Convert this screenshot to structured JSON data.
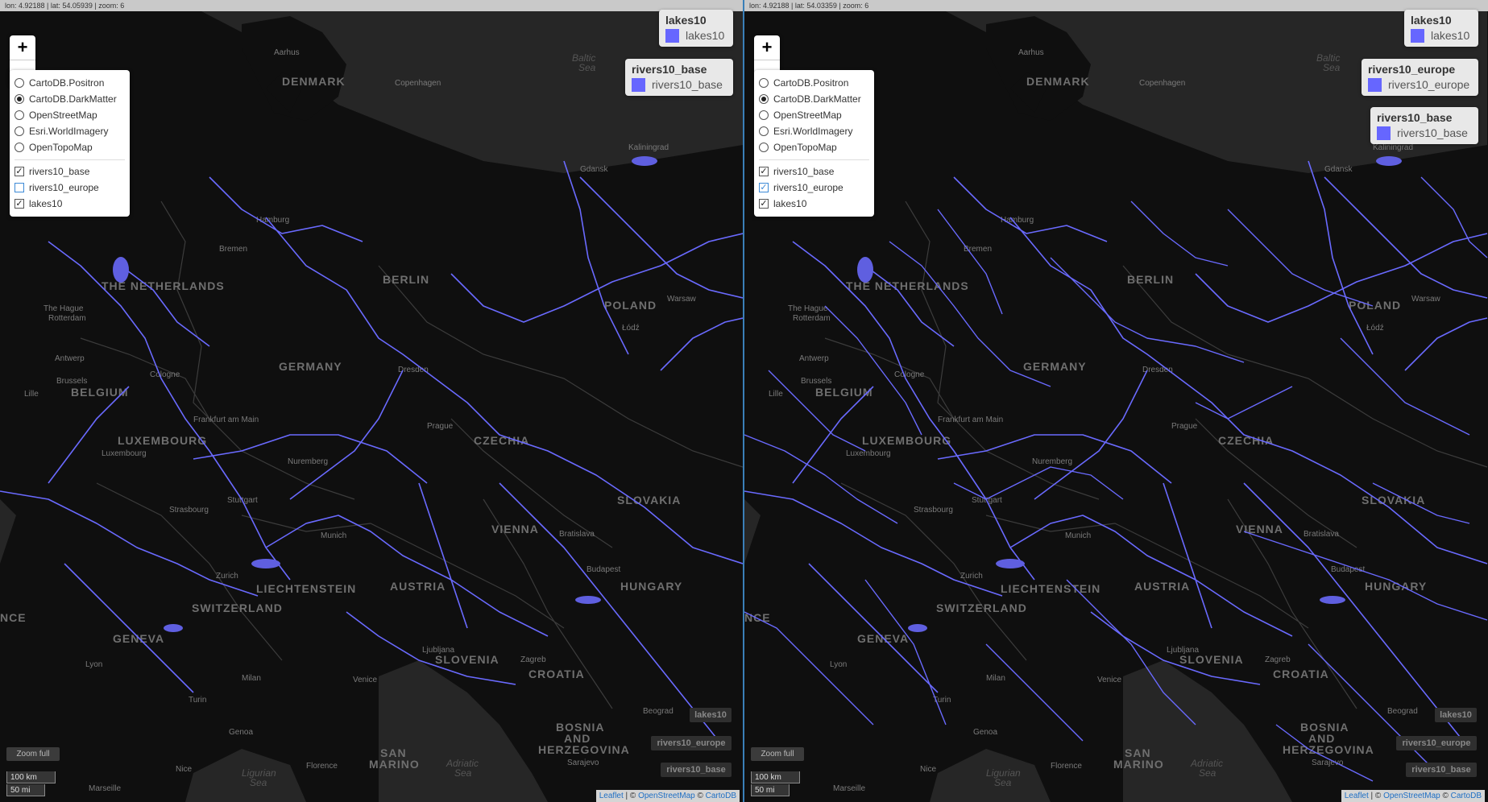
{
  "left": {
    "coords": "lon: 4.92188 | lat: 54.05939 | zoom: 6",
    "layers": {
      "basemaps": [
        {
          "label": "CartoDB.Positron",
          "selected": false
        },
        {
          "label": "CartoDB.DarkMatter",
          "selected": true
        },
        {
          "label": "OpenStreetMap",
          "selected": false
        },
        {
          "label": "Esri.WorldImagery",
          "selected": false
        },
        {
          "label": "OpenTopoMap",
          "selected": false
        }
      ],
      "overlays": [
        {
          "label": "rivers10_base",
          "checked": true
        },
        {
          "label": "rivers10_europe",
          "checked": false
        },
        {
          "label": "lakes10",
          "checked": true
        }
      ]
    },
    "legends": [
      {
        "title": "lakes10",
        "item": "lakes10"
      },
      {
        "title": "rivers10_base",
        "item": "rivers10_base"
      }
    ],
    "hidden_buttons": [
      "lakes10",
      "rivers10_europe",
      "rivers10_base"
    ]
  },
  "right": {
    "coords": "lon: 4.92188 | lat: 54.03359 | zoom: 6",
    "layers": {
      "basemaps": [
        {
          "label": "CartoDB.Positron",
          "selected": false
        },
        {
          "label": "CartoDB.DarkMatter",
          "selected": true
        },
        {
          "label": "OpenStreetMap",
          "selected": false
        },
        {
          "label": "Esri.WorldImagery",
          "selected": false
        },
        {
          "label": "OpenTopoMap",
          "selected": false
        }
      ],
      "overlays": [
        {
          "label": "rivers10_base",
          "checked": true
        },
        {
          "label": "rivers10_europe",
          "checked": true
        },
        {
          "label": "lakes10",
          "checked": true
        }
      ]
    },
    "legends": [
      {
        "title": "lakes10",
        "item": "lakes10"
      },
      {
        "title": "rivers10_europe",
        "item": "rivers10_europe"
      },
      {
        "title": "rivers10_base",
        "item": "rivers10_base"
      }
    ],
    "hidden_buttons": [
      "lakes10",
      "rivers10_europe",
      "rivers10_base"
    ]
  },
  "controls": {
    "zoom_in": "+",
    "zoom_out": "−",
    "zoom_full": "Zoom full",
    "scale_km": "100 km",
    "scale_mi": "50 mi"
  },
  "attribution": {
    "leaflet": "Leaflet",
    "osm": "OpenStreetMap",
    "carto": "CartoDB",
    "sep1": " | © ",
    "sep2": " © "
  },
  "places": {
    "denmark": "DENMARK",
    "copenhagen": "Copenhagen",
    "aarhus": "Aarhus",
    "baltic1": "Baltic",
    "baltic2": "Sea",
    "kaliningrad": "Kaliningrad",
    "gdansk": "Gdansk",
    "hamburg": "Hamburg",
    "bremen": "Bremen",
    "netherlands": "THE NETHERLANDS",
    "the_hague": "The Hague",
    "rotterdam": "Rotterdam",
    "berlin": "BERLIN",
    "poland": "POLAND",
    "warsaw": "Warsaw",
    "lodz": "Łódź",
    "antwerp": "Antwerp",
    "brussels": "Brussels",
    "belgium": "BELGIUM",
    "cologne": "Cologne",
    "lille": "Lille",
    "germany": "GERMANY",
    "dresden": "Dresden",
    "frankfurt": "Frankfurt am Main",
    "prague": "Prague",
    "luxembourg_c": "LUXEMBOURG",
    "luxembourg": "Luxembourg",
    "czechia": "CZECHIA",
    "nuremberg": "Nuremberg",
    "stuttgart": "Stuttgart",
    "strasbourg": "Strasbourg",
    "slovakia": "SLOVAKIA",
    "vienna": "VIENNA",
    "bratislava": "Bratislava",
    "munich": "Munich",
    "budapest": "Budapest",
    "zurich": "Zurich",
    "liechtenstein": "LIECHTENSTEIN",
    "austria": "AUSTRIA",
    "hungary": "HUNGARY",
    "switzerland": "SWITZERLAND",
    "geneva": "GENEVA",
    "nce": "NCE",
    "lyon": "Lyon",
    "ljubljana": "Ljubljana",
    "slovenia": "SLOVENIA",
    "zagreb": "Zagreb",
    "croatia": "CROATIA",
    "milan": "Milan",
    "venice": "Venice",
    "turin": "Turin",
    "genoa": "Genoa",
    "beograd": "Beograd",
    "bosnia": "BOSNIA",
    "and": "AND",
    "herzegovina": "HERZEGOVINA",
    "sarajevo": "Sarajevo",
    "san": "SAN",
    "marino": "MARINO",
    "adriatic1": "Adriatic",
    "adriatic2": "Sea",
    "florence": "Florence",
    "nice": "Nice",
    "ligurian1": "Ligurian",
    "ligurian2": "Sea",
    "marseille": "Marseille"
  },
  "colors": {
    "river": "#6a6aff",
    "lake": "#5f5fe0",
    "land": "#0f0f0f",
    "border": "#3c3c3c",
    "sea": "#262626"
  }
}
